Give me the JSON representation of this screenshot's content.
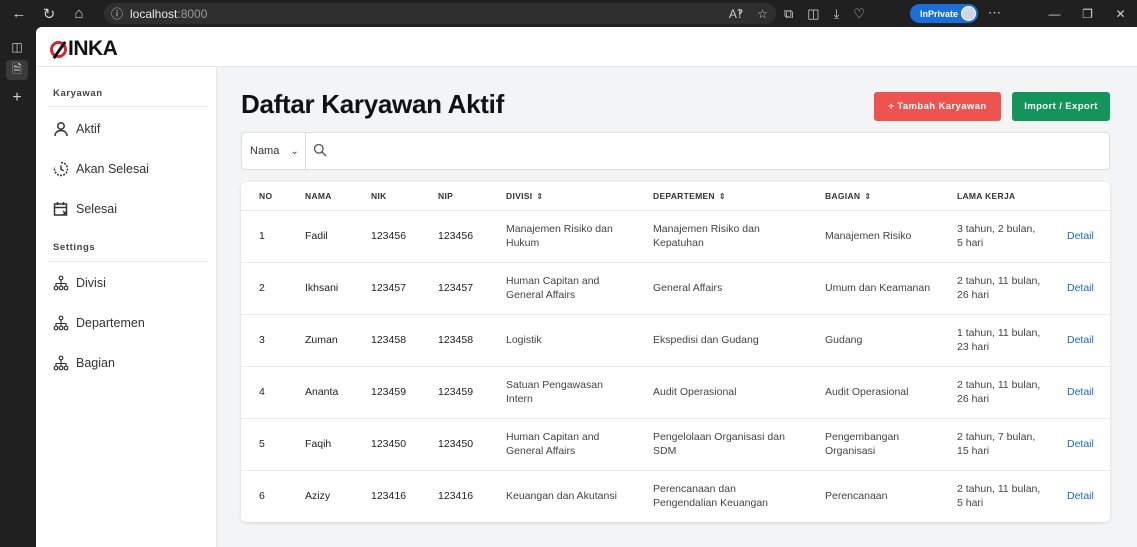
{
  "browser": {
    "url_host": "localhost",
    "url_port": ":8000",
    "inprivate_label": "InPrivate"
  },
  "app": {
    "logo_text": "INKA"
  },
  "sidebar": {
    "section_karyawan": "Karyawan",
    "section_settings": "Settings",
    "items": [
      {
        "label": "Aktif",
        "icon": "user-icon"
      },
      {
        "label": "Akan Selesai",
        "icon": "clock-icon"
      },
      {
        "label": "Selesai",
        "icon": "calendar-x-icon"
      },
      {
        "label": "Divisi",
        "icon": "org-chart-icon"
      },
      {
        "label": "Departemen",
        "icon": "org-chart-icon"
      },
      {
        "label": "Bagian",
        "icon": "org-chart-icon"
      }
    ]
  },
  "main": {
    "title": "Daftar Karyawan Aktif",
    "add_button": "+ Tambah Karyawan",
    "import_button": "Import / Export",
    "filter_selected": "Nama",
    "search_placeholder": ""
  },
  "table": {
    "columns": [
      "NO",
      "NAMA",
      "NIK",
      "NIP",
      "DIVISI",
      "DEPARTEMEN",
      "BAGIAN",
      "LAMA KERJA",
      ""
    ],
    "detail_label": "Detail",
    "rows": [
      {
        "no": "1",
        "nama": "Fadil",
        "nik": "123456",
        "nip": "123456",
        "divisi": "Manajemen Risiko dan Hukum",
        "departemen": "Manajemen Risiko dan Kepatuhan",
        "bagian": "Manajemen Risiko",
        "lama": "3 tahun, 2 bulan, 5 hari"
      },
      {
        "no": "2",
        "nama": "Ikhsani",
        "nik": "123457",
        "nip": "123457",
        "divisi": "Human Capitan and General Affairs",
        "departemen": "General Affairs",
        "bagian": "Umum dan Keamanan",
        "lama": "2 tahun, 11 bulan, 26 hari"
      },
      {
        "no": "3",
        "nama": "Zuman",
        "nik": "123458",
        "nip": "123458",
        "divisi": "Logistik",
        "departemen": "Ekspedisi dan Gudang",
        "bagian": "Gudang",
        "lama": "1 tahun, 11 bulan, 23 hari"
      },
      {
        "no": "4",
        "nama": "Ananta",
        "nik": "123459",
        "nip": "123459",
        "divisi": "Satuan Pengawasan Intern",
        "departemen": "Audit Operasional",
        "bagian": "Audit Operasional",
        "lama": "2 tahun, 11 bulan, 26 hari"
      },
      {
        "no": "5",
        "nama": "Faqih",
        "nik": "123450",
        "nip": "123450",
        "divisi": "Human Capitan and General Affairs",
        "departemen": "Pengelolaan Organisasi dan SDM",
        "bagian": "Pengembangan Organisasi",
        "lama": "2 tahun, 7 bulan, 15 hari"
      },
      {
        "no": "6",
        "nama": "Azizy",
        "nik": "123416",
        "nip": "123416",
        "divisi": "Keuangan dan Akutansi",
        "departemen": "Perencanaan dan Pengendalian Keuangan",
        "bagian": "Perencanaan",
        "lama": "2 tahun, 11 bulan, 5 hari"
      }
    ]
  },
  "colors": {
    "add_button": "#ef5350",
    "import_button": "#12945a",
    "link": "#1a66d6",
    "brand_red": "#d7262b"
  }
}
